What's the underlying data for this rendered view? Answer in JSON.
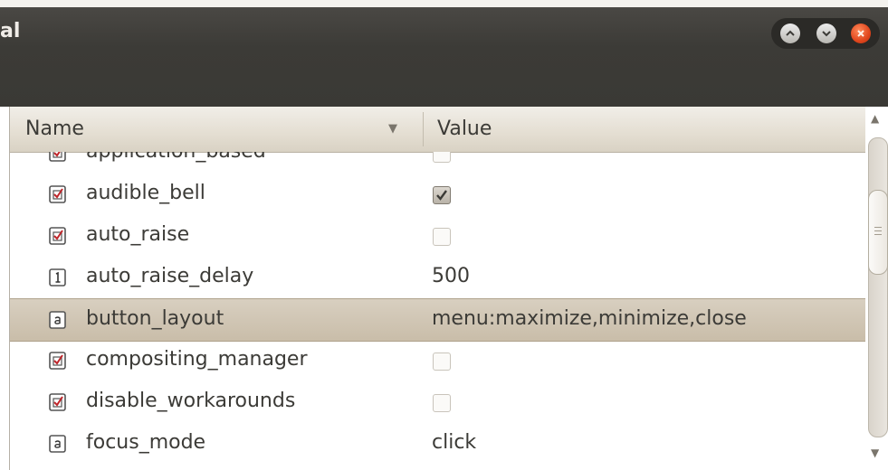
{
  "window": {
    "title": "al",
    "controls": [
      "maximize-icon",
      "minimize-icon",
      "close-icon"
    ]
  },
  "columns": {
    "name": "Name",
    "value": "Value",
    "sort_indicator": "▼"
  },
  "rows": [
    {
      "name": "application_based",
      "type": "bool",
      "checked": false,
      "icon": "bool-key-icon"
    },
    {
      "name": "audible_bell",
      "type": "bool",
      "checked": true,
      "icon": "bool-key-icon"
    },
    {
      "name": "auto_raise",
      "type": "bool",
      "checked": false,
      "icon": "bool-key-icon"
    },
    {
      "name": "auto_raise_delay",
      "type": "int",
      "value": "500",
      "icon": "int-key-icon"
    },
    {
      "name": "button_layout",
      "type": "string",
      "value": "menu:maximize,minimize,close",
      "icon": "string-key-icon",
      "selected": true
    },
    {
      "name": "compositing_manager",
      "type": "bool",
      "checked": false,
      "icon": "bool-key-icon"
    },
    {
      "name": "disable_workarounds",
      "type": "bool",
      "checked": false,
      "icon": "bool-key-icon"
    },
    {
      "name": "focus_mode",
      "type": "string",
      "value": "click",
      "icon": "string-key-icon"
    }
  ],
  "colors": {
    "titlebar": "#3c3b37",
    "selection": "#cdc3b1",
    "close_button": "#e0461d"
  }
}
